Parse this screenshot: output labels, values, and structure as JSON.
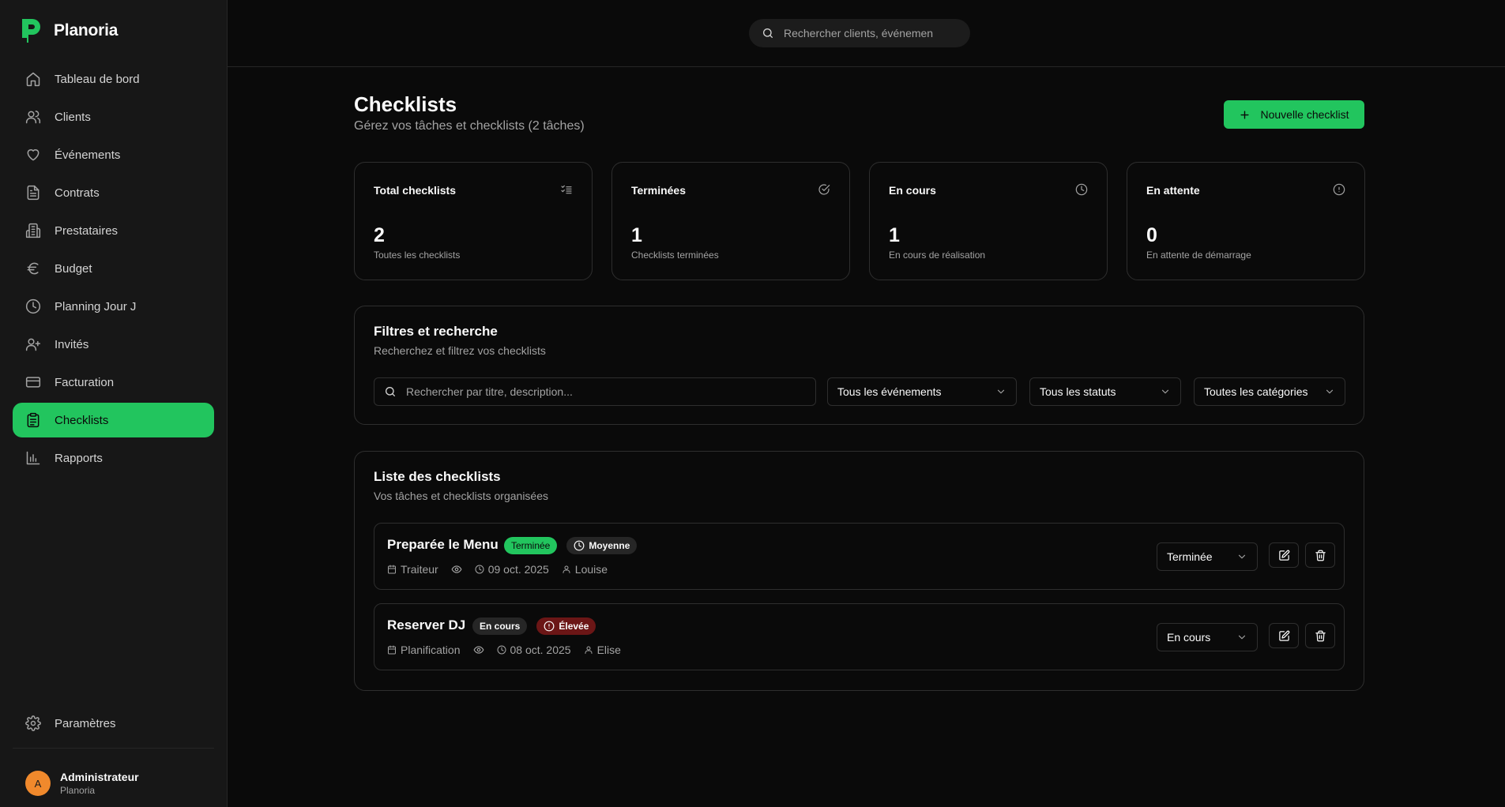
{
  "brand": {
    "name": "Planoria",
    "accent": "#22c55e"
  },
  "sidebar": {
    "items": [
      {
        "label": "Tableau de bord",
        "icon": "home-icon"
      },
      {
        "label": "Clients",
        "icon": "users-icon"
      },
      {
        "label": "Événements",
        "icon": "heart-icon"
      },
      {
        "label": "Contrats",
        "icon": "document-icon"
      },
      {
        "label": "Prestataires",
        "icon": "building-icon"
      },
      {
        "label": "Budget",
        "icon": "euro-icon"
      },
      {
        "label": "Planning Jour J",
        "icon": "clock-icon"
      },
      {
        "label": "Invités",
        "icon": "user-plus-icon"
      },
      {
        "label": "Facturation",
        "icon": "credit-card-icon"
      },
      {
        "label": "Checklists",
        "icon": "clipboard-icon",
        "active": true
      },
      {
        "label": "Rapports",
        "icon": "bar-chart-icon"
      }
    ],
    "settings": {
      "label": "Paramètres",
      "icon": "gear-icon"
    },
    "user": {
      "initial": "A",
      "name": "Administrateur",
      "org": "Planoria",
      "avatar_color": "#f0892c"
    }
  },
  "topbar": {
    "search_placeholder": "Rechercher clients, événemen"
  },
  "page": {
    "title": "Checklists",
    "subtitle": "Gérez vos tâches et checklists (2 tâches)",
    "new_button": "Nouvelle checklist"
  },
  "stats": [
    {
      "label": "Total checklists",
      "value": "2",
      "desc": "Toutes les checklists",
      "icon": "list-check-icon"
    },
    {
      "label": "Terminées",
      "value": "1",
      "desc": "Checklists terminées",
      "icon": "check-circle-icon"
    },
    {
      "label": "En cours",
      "value": "1",
      "desc": "En cours de réalisation",
      "icon": "clock-icon"
    },
    {
      "label": "En attente",
      "value": "0",
      "desc": "En attente de démarrage",
      "icon": "alert-circle-icon"
    }
  ],
  "filters": {
    "title": "Filtres et recherche",
    "subtitle": "Recherchez et filtrez vos checklists",
    "search_placeholder": "Rechercher par titre, description...",
    "event_select": "Tous les événements",
    "status_select": "Tous les statuts",
    "category_select": "Toutes les catégories"
  },
  "list": {
    "title": "Liste des checklists",
    "subtitle": "Vos tâches et checklists organisées",
    "items": [
      {
        "title": "Preparée le Menu",
        "status_badge": "Terminée",
        "priority_badge": "Moyenne",
        "category": "Traiteur",
        "date": "09 oct. 2025",
        "assignee": "Louise",
        "status_select": "Terminée"
      },
      {
        "title": "Reserver DJ",
        "status_badge": "En cours",
        "priority_badge": "Élevée",
        "category": "Planification",
        "date": "08 oct. 2025",
        "assignee": "Elise",
        "status_select": "En cours"
      }
    ]
  }
}
